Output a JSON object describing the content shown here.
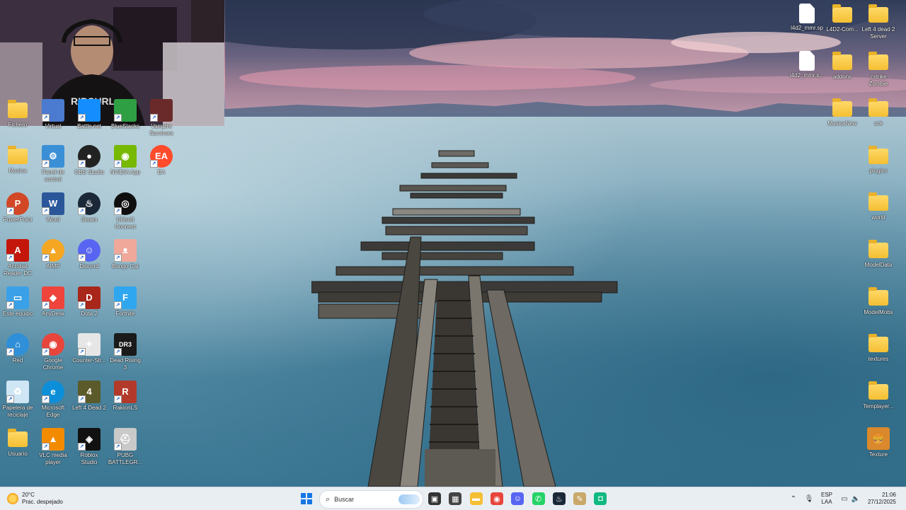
{
  "desktop": {
    "left_icons": [
      {
        "name": "fichero-folder",
        "label": "Fichero",
        "type": "folder",
        "col": 0,
        "row": 0,
        "clipped": true
      },
      {
        "name": "virtual-icon",
        "label": "Virtual",
        "type": "app",
        "col": 1,
        "row": 0,
        "clipped": true,
        "color": "#4a7bd0"
      },
      {
        "name": "battlenet-icon",
        "label": "Battle.net",
        "type": "app",
        "col": 2,
        "row": 0,
        "clipped": true,
        "color": "#148eff"
      },
      {
        "name": "bluestacks-icon",
        "label": "BlueStacks",
        "type": "app",
        "col": 3,
        "row": 0,
        "clipped": true,
        "color": "#2ea043"
      },
      {
        "name": "vampire-survivors-icon",
        "label": "Vampire\nSurvivors",
        "type": "app",
        "col": 4,
        "row": 0,
        "clipped": true,
        "color": "#6b2a2a"
      },
      {
        "name": "musica-folder",
        "label": "Musica",
        "type": "folder",
        "col": 0,
        "row": 1
      },
      {
        "name": "panel-de-control-icon",
        "label": "Panel de\ncontrol",
        "type": "app",
        "col": 1,
        "row": 1,
        "color": "#3b8fd6",
        "glyph": "⚙"
      },
      {
        "name": "obs-studio-icon",
        "label": "OBS Studio",
        "type": "app",
        "col": 2,
        "row": 1,
        "color": "#222",
        "glyph": "●",
        "round": true
      },
      {
        "name": "nvidia-app-icon",
        "label": "NVIDIA App",
        "type": "app",
        "col": 3,
        "row": 1,
        "color": "#76b900",
        "glyph": "◉"
      },
      {
        "name": "ea-icon",
        "label": "EA",
        "type": "app",
        "col": 4,
        "row": 1,
        "color": "#ff4b2b",
        "glyph": "EA",
        "round": true
      },
      {
        "name": "powerpoint-icon",
        "label": "PowerPoint",
        "type": "app",
        "col": 0,
        "row": 2,
        "color": "#d24726",
        "glyph": "P",
        "round": true
      },
      {
        "name": "word-icon",
        "label": "Word",
        "type": "app",
        "col": 1,
        "row": 2,
        "color": "#2b579a",
        "glyph": "W"
      },
      {
        "name": "steam-icon",
        "label": "Steam",
        "type": "app",
        "col": 2,
        "row": 2,
        "color": "#1b2838",
        "glyph": "♨",
        "round": true
      },
      {
        "name": "ubisoft-connect-icon",
        "label": "Ubisoft\nConnect",
        "type": "app",
        "col": 3,
        "row": 2,
        "color": "#0e0e0e",
        "glyph": "◎",
        "round": true
      },
      {
        "name": "acrobat-reader-icon",
        "label": "Acrobat\nReader DC",
        "type": "app",
        "col": 0,
        "row": 3,
        "color": "#c4160a",
        "glyph": "A"
      },
      {
        "name": "aimp-icon",
        "label": "AIMP",
        "type": "app",
        "col": 1,
        "row": 3,
        "color": "#f5a623",
        "glyph": "▲",
        "round": true
      },
      {
        "name": "discord-icon",
        "label": "Discord",
        "type": "app",
        "col": 2,
        "row": 3,
        "color": "#5865f2",
        "glyph": "☺",
        "round": true
      },
      {
        "name": "bongo-cat-icon",
        "label": "Bongo Cat",
        "type": "app",
        "col": 3,
        "row": 3,
        "color": "#f0a89a",
        "glyph": "ᴥ"
      },
      {
        "name": "este-equipo-icon",
        "label": "Este equipo",
        "type": "app",
        "col": 0,
        "row": 4,
        "color": "#3aa0e8",
        "glyph": "▭"
      },
      {
        "name": "anydesk-icon",
        "label": "AnyDesk",
        "type": "app",
        "col": 1,
        "row": 4,
        "color": "#ef443b",
        "glyph": "◆"
      },
      {
        "name": "dota2-icon",
        "label": "Dota 2",
        "type": "app",
        "col": 2,
        "row": 4,
        "color": "#a8261a",
        "glyph": "D"
      },
      {
        "name": "fortnite-icon",
        "label": "Fortnite",
        "type": "app",
        "col": 3,
        "row": 4,
        "color": "#2fa7f0",
        "glyph": "F"
      },
      {
        "name": "red-icon",
        "label": "Red",
        "type": "app",
        "col": 0,
        "row": 5,
        "color": "#2f8fd8",
        "glyph": "⌂",
        "round": true
      },
      {
        "name": "google-chrome-icon",
        "label": "Google\nChrome",
        "type": "app",
        "col": 1,
        "row": 5,
        "color": "#e8453c",
        "glyph": "◉",
        "round": true
      },
      {
        "name": "counter-strike-icon",
        "label": "Counter-Str...",
        "type": "app",
        "col": 2,
        "row": 5,
        "color": "#e6e6e6",
        "glyph": "✦"
      },
      {
        "name": "dead-rising-3-icon",
        "label": "Dead Rising 3",
        "type": "app",
        "col": 3,
        "row": 5,
        "color": "#1a1a1a",
        "glyph": "DR3"
      },
      {
        "name": "papelera-icon",
        "label": "Papelera de\nreciclaje",
        "type": "app",
        "col": 0,
        "row": 6,
        "color": "#cfe6f5",
        "glyph": "♻"
      },
      {
        "name": "microsoft-edge-icon",
        "label": "Microsoft\nEdge",
        "type": "app",
        "col": 1,
        "row": 6,
        "color": "#0c8fd8",
        "glyph": "e",
        "round": true
      },
      {
        "name": "left4dead2-icon",
        "label": "Left 4 Dead 2",
        "type": "app",
        "col": 2,
        "row": 6,
        "color": "#5b5a2a",
        "glyph": "4"
      },
      {
        "name": "rakionls-icon",
        "label": "RakionLS",
        "type": "app",
        "col": 3,
        "row": 6,
        "color": "#b33a2a",
        "glyph": "R"
      },
      {
        "name": "usuario-folder",
        "label": "Usuario",
        "type": "folder",
        "col": 0,
        "row": 7
      },
      {
        "name": "vlc-icon",
        "label": "VLC media\nplayer",
        "type": "app",
        "col": 1,
        "row": 7,
        "color": "#f28b00",
        "glyph": "▲"
      },
      {
        "name": "roblox-studio-icon",
        "label": "Roblox\nStudio",
        "type": "app",
        "col": 2,
        "row": 7,
        "color": "#111",
        "glyph": "◈"
      },
      {
        "name": "pubg-icon",
        "label": "PUBG\nBATTLEGR...",
        "type": "app",
        "col": 3,
        "row": 7,
        "color": "#c9c9c9",
        "glyph": "⛑"
      }
    ],
    "right_icons": [
      {
        "name": "l4d2-mmr-sp-file",
        "label": "l4d2_mmr.sp",
        "type": "file",
        "col": 0,
        "row": 0
      },
      {
        "name": "l4d2-com-folder",
        "label": "L4D2-Com...",
        "type": "folder",
        "col": 1,
        "row": 0
      },
      {
        "name": "left4dead2-server-folder",
        "label": "Left 4 dead 2\nServer",
        "type": "folder",
        "col": 2,
        "row": 0
      },
      {
        "name": "l4d2-mmr-file",
        "label": "l4d2_mmr.s...",
        "type": "file",
        "col": 0,
        "row": 1
      },
      {
        "name": "addons-folder",
        "label": "addons",
        "type": "folder",
        "col": 1,
        "row": 1
      },
      {
        "name": "cstrike-zombie-folder",
        "label": "cstrike\nZombie",
        "type": "folder",
        "col": 2,
        "row": 1
      },
      {
        "name": "musicanew-folder",
        "label": "MusicaNew",
        "type": "folder",
        "col": 1,
        "row": 2
      },
      {
        "name": "sck-folder",
        "label": "sck",
        "type": "folder",
        "col": 2,
        "row": 2
      },
      {
        "name": "plugins-folder",
        "label": "plugins",
        "type": "folder",
        "col": 2,
        "row": 3
      },
      {
        "name": "world-folder",
        "label": "world",
        "type": "folder",
        "col": 2,
        "row": 4
      },
      {
        "name": "modeldata-folder",
        "label": "ModelData",
        "type": "folder",
        "col": 2,
        "row": 5
      },
      {
        "name": "modelmobs-folder",
        "label": "ModelMobs",
        "type": "folder",
        "col": 2,
        "row": 6
      },
      {
        "name": "textures-folder",
        "label": "textures",
        "type": "folder",
        "col": 2,
        "row": 7
      },
      {
        "name": "templayer-folder",
        "label": "Templayer...",
        "type": "folder",
        "col": 2,
        "row": 8
      },
      {
        "name": "texture-icon",
        "label": "Texture",
        "type": "app",
        "col": 2,
        "row": 9,
        "color": "#d9892b",
        "glyph": "🍔"
      }
    ]
  },
  "taskbar": {
    "weather": {
      "temp": "20°C",
      "condition": "Prac. despejado"
    },
    "search_placeholder": "Buscar",
    "apps": [
      {
        "name": "windows-start-icon",
        "glyph": "⊞",
        "color": "#1677e5"
      },
      {
        "name": "task-view-icon",
        "glyph": "▣",
        "color": "#333"
      },
      {
        "name": "microsoft-store-icon",
        "glyph": "▦",
        "color": "#444"
      },
      {
        "name": "file-explorer-icon",
        "glyph": "▬",
        "color": "#f4bf32"
      },
      {
        "name": "chrome-taskbar-icon",
        "glyph": "◉",
        "color": "#e8453c"
      },
      {
        "name": "discord-taskbar-icon",
        "glyph": "☺",
        "color": "#5865f2"
      },
      {
        "name": "whatsapp-taskbar-icon",
        "glyph": "✆",
        "color": "#25d366"
      },
      {
        "name": "steam-taskbar-icon",
        "glyph": "♨",
        "color": "#1b2838"
      },
      {
        "name": "cheat-app-taskbar-icon",
        "glyph": "✎",
        "color": "#c9a86a"
      },
      {
        "name": "green-app-taskbar-icon",
        "glyph": "◘",
        "color": "#10b981"
      }
    ],
    "discord_badge": "",
    "language": {
      "code": "ESP",
      "layout": "LAA"
    },
    "clock": {
      "time": "21:06",
      "date": "27/12/2025"
    }
  }
}
